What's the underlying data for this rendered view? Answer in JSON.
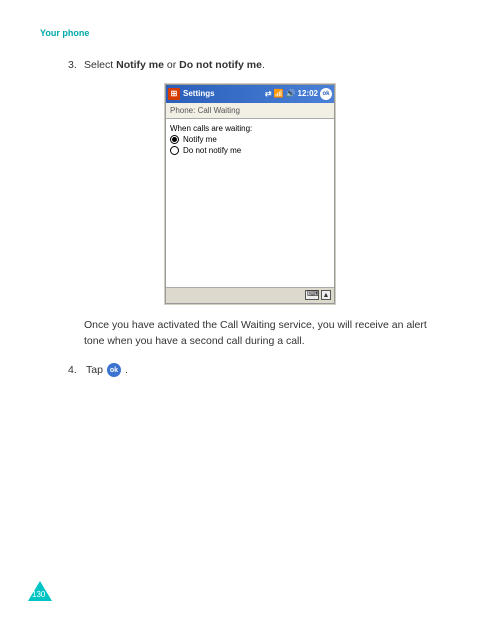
{
  "header": {
    "section": "Your phone"
  },
  "step3": {
    "num": "3.",
    "prefix": "Select ",
    "opt1": "Notify me",
    "mid": " or ",
    "opt2": "Do not notify me",
    "suffix": "."
  },
  "phone": {
    "titlebar": {
      "title": "Settings",
      "time": "12:02"
    },
    "subheader": "Phone: Call Waiting",
    "content": {
      "prompt": "When calls are waiting:",
      "option1": "Notify me",
      "option2": "Do not notify me"
    }
  },
  "body_after": "Once you have activated the Call Waiting service, you will receive an alert tone when you have a second call during a call.",
  "step4": {
    "num": "4.",
    "prefix": "Tap ",
    "ok": "ok",
    "suffix": "."
  },
  "page": "130"
}
